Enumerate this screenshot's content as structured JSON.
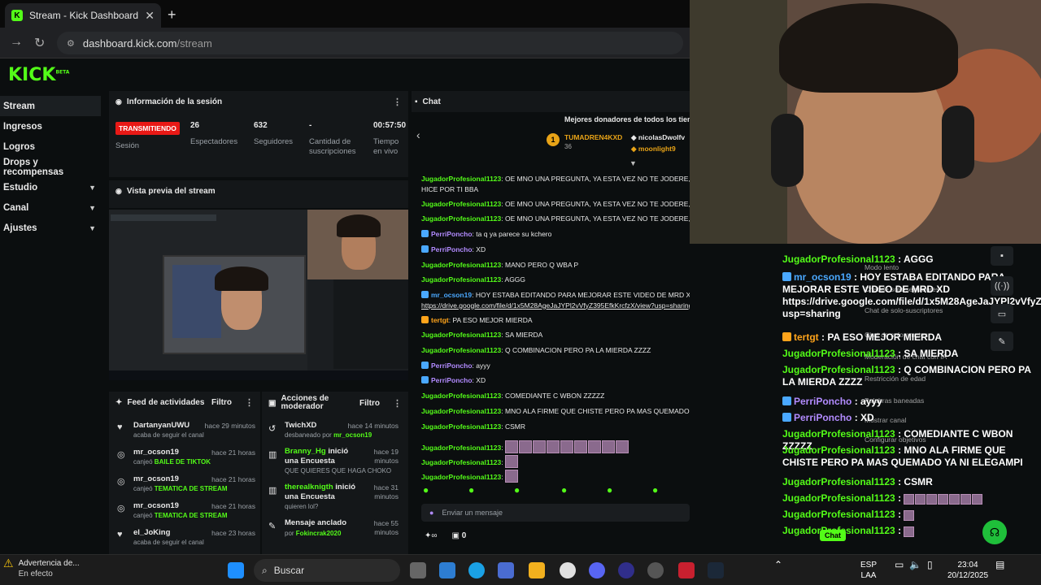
{
  "browser": {
    "tab_title": "Stream - Kick Dashboard",
    "tab_close": "✕",
    "new_tab": "+",
    "url_domain": "dashboard.kick.com",
    "url_path": "/stream"
  },
  "brand": {
    "logo": "KICK",
    "logo_sup": "BETA",
    "accent": "#53fc18"
  },
  "sidebar": {
    "items": [
      {
        "label": "Stream",
        "active": true
      },
      {
        "label": "Ingresos"
      },
      {
        "label": "Logros"
      },
      {
        "label": "Drops y recompensas"
      },
      {
        "label": "Estudio",
        "expandable": true
      },
      {
        "label": "Canal",
        "expandable": true
      },
      {
        "label": "Ajustes",
        "expandable": true
      }
    ]
  },
  "session": {
    "title": "Información de la sesión",
    "status": "TRANSMITIENDO",
    "status_label": "Sesión",
    "viewers": "26",
    "viewers_label": "Espectadores",
    "followers": "632",
    "followers_label": "Seguidores",
    "subs": "-",
    "subs_label": "Cantidad de suscripciones",
    "uptime": "00:57:50",
    "uptime_label": "Tiempo en vivo"
  },
  "preview": {
    "title": "Vista previa del stream"
  },
  "activity": {
    "title": "Feed de actividades",
    "filter": "Filtro",
    "items": [
      {
        "icon": "heart-icon",
        "name": "DartanyanUWU",
        "time": "hace 29 minutos",
        "desc": "acaba de seguir el canal",
        "highlight": ""
      },
      {
        "icon": "redeem-icon",
        "name": "mr_ocson19",
        "time": "hace 21 horas",
        "desc": "canjeó ",
        "highlight": "BAILE DE TIKTOK"
      },
      {
        "icon": "redeem-icon",
        "name": "mr_ocson19",
        "time": "hace 21 horas",
        "desc": "canjeó ",
        "highlight": "TEMATICA DE STREAM"
      },
      {
        "icon": "redeem-icon",
        "name": "mr_ocson19",
        "time": "hace 21 horas",
        "desc": "canjeó ",
        "highlight": "TEMATICA DE STREAM"
      },
      {
        "icon": "heart-icon",
        "name": "el_JoKing",
        "time": "hace 23 horas",
        "desc": "acaba de seguir el canal",
        "highlight": ""
      }
    ]
  },
  "modactions": {
    "title": "Acciones de moderador",
    "filter": "Filtro",
    "items": [
      {
        "name": "TwichXD",
        "time": "hace 14 minutos",
        "desc": "desbaneado por ",
        "by": "mr_ocson19"
      },
      {
        "name": "Branny_Hg",
        "suffix": " inició una Encuesta",
        "time": "hace 19 minutos",
        "desc": "QUE QUIERES QUE HAGA CHOKO"
      },
      {
        "name": "therealknigth",
        "suffix": " inició una Encuesta",
        "time": "hace 31 minutos",
        "desc": "quieren lol?"
      },
      {
        "name": "Mensaje anclado",
        "time": "hace 55 minutos",
        "desc": "por ",
        "by": "Fokincrak2020"
      }
    ]
  },
  "chat": {
    "title": "Chat",
    "top_donors": "Mejores donadores de todos los tiem",
    "donors": [
      {
        "rank": "1",
        "name": "TUMADREN4KXD",
        "amount": "36"
      },
      {
        "name": "nicolasDwolfv"
      },
      {
        "name": "moonlight9"
      }
    ],
    "messages": [
      {
        "user": "JugadorProfesional1123",
        "color": "green",
        "text": "OE MNO UNA PREGUNTA, YA ESTA VEZ NO TE JODERE, Q I",
        "text2": "HICE POR TI BBA"
      },
      {
        "user": "JugadorProfesional1123",
        "color": "green",
        "text": "OE MNO UNA PREGUNTA, YA ESTA VEZ NO TE JODERE, Q I"
      },
      {
        "user": "JugadorProfesional1123",
        "color": "green",
        "text": "OE MNO UNA PREGUNTA, YA ESTA VEZ NO TE JODERE, Q I"
      },
      {
        "user": "PerriPoncho",
        "color": "purple",
        "badge": "b",
        "text": "ta q ya parece su kchero"
      },
      {
        "user": "PerriPoncho",
        "color": "purple",
        "badge": "b",
        "text": "XD"
      },
      {
        "user": "JugadorProfesional1123",
        "color": "green",
        "text": "MANO PERO Q WBA P"
      },
      {
        "user": "JugadorProfesional1123",
        "color": "green",
        "text": "AGGG"
      },
      {
        "user": "mr_ocson19",
        "color": "blue",
        "badge": "b",
        "text": "HOY ESTABA EDITANDO PARA MEJORAR ESTE VIDEO DE MRD XD",
        "text2": "https://drive.google.com/file/d/1x5M28AgeJaJYPl2vVfyZ395EfkKrcfzX/view?usp=sharing"
      },
      {
        "user": "tertgt",
        "color": "orange",
        "badge": "o",
        "text": "PA ESO MEJOR MIERDA"
      },
      {
        "user": "JugadorProfesional1123",
        "color": "green",
        "text": "SA MIERDA"
      },
      {
        "user": "JugadorProfesional1123",
        "color": "green",
        "text": "Q COMBINACION PERO PA LA MIERDA ZZZZ"
      },
      {
        "user": "PerriPoncho",
        "color": "purple",
        "badge": "b",
        "text": "ayyy"
      },
      {
        "user": "PerriPoncho",
        "color": "purple",
        "badge": "b",
        "text": "XD"
      },
      {
        "user": "JugadorProfesional1123",
        "color": "green",
        "text": "COMEDIANTE C WBON ZZZZZ"
      },
      {
        "user": "JugadorProfesional1123",
        "color": "green",
        "text": "MNO ALA FIRME QUE CHISTE PERO PA MAS QUEMADO YA NI ELEGAMPI"
      },
      {
        "user": "JugadorProfesional1123",
        "color": "green",
        "text": "CSMR"
      }
    ],
    "input_placeholder": "Enviar un mensaje",
    "points": "0"
  },
  "overlay": {
    "messages": [
      {
        "user": "JugadorProfesional1123",
        "color": "green",
        "text": "AGGG"
      },
      {
        "user": "mr_ocson19",
        "color": "blue",
        "badge": "b",
        "text": "HOY ESTABA EDITANDO PARA MEJORAR ESTE VIDEO DE MRD XD https://drive.google.com/file/d/1x5M28AgeJaJYPl2vVfyZ395EfkKrcfzX/view?usp=sharing"
      },
      {
        "user": "tertgt",
        "color": "orange",
        "badge": "o",
        "text": "PA ESO MEJOR MIERDA"
      },
      {
        "user": "JugadorProfesional1123",
        "color": "green",
        "text": "SA MIERDA"
      },
      {
        "user": "JugadorProfesional1123",
        "color": "green",
        "text": "Q COMBINACION PERO PA LA MIERDA ZZZZ"
      },
      {
        "user": "PerriPoncho",
        "color": "purple",
        "badge": "b",
        "text": "ayyy"
      },
      {
        "user": "PerriPoncho",
        "color": "purple",
        "badge": "b",
        "text": "XD"
      },
      {
        "user": "JugadorProfesional1123",
        "color": "green",
        "text": "COMEDIANTE C WBON ZZZZZ"
      },
      {
        "user": "JugadorProfesional1123",
        "color": "green",
        "text": "MNO ALA FIRME QUE CHISTE PERO PA MAS QUEMADO YA NI ELEGAMPI"
      },
      {
        "user": "JugadorProfesional1123",
        "color": "green",
        "text": "CSMR"
      }
    ],
    "menu": [
      "Modo lento",
      "Chat de solo-seguidores",
      "Chat de solo-suscriptores",
      "Chat de solo emotes",
      "Moderación de chat con IA",
      "Restricción de edad",
      "Palabras baneadas",
      "Mostrar canal",
      "Configurar objetivos"
    ],
    "chat_button": "Chat"
  },
  "taskbar": {
    "notification_title": "Advertencia de...",
    "notification_sub": "En efecto",
    "search": "Buscar",
    "lang1": "ESP",
    "lang2": "LAA",
    "time": "23:04",
    "date": "20/12/2025"
  }
}
